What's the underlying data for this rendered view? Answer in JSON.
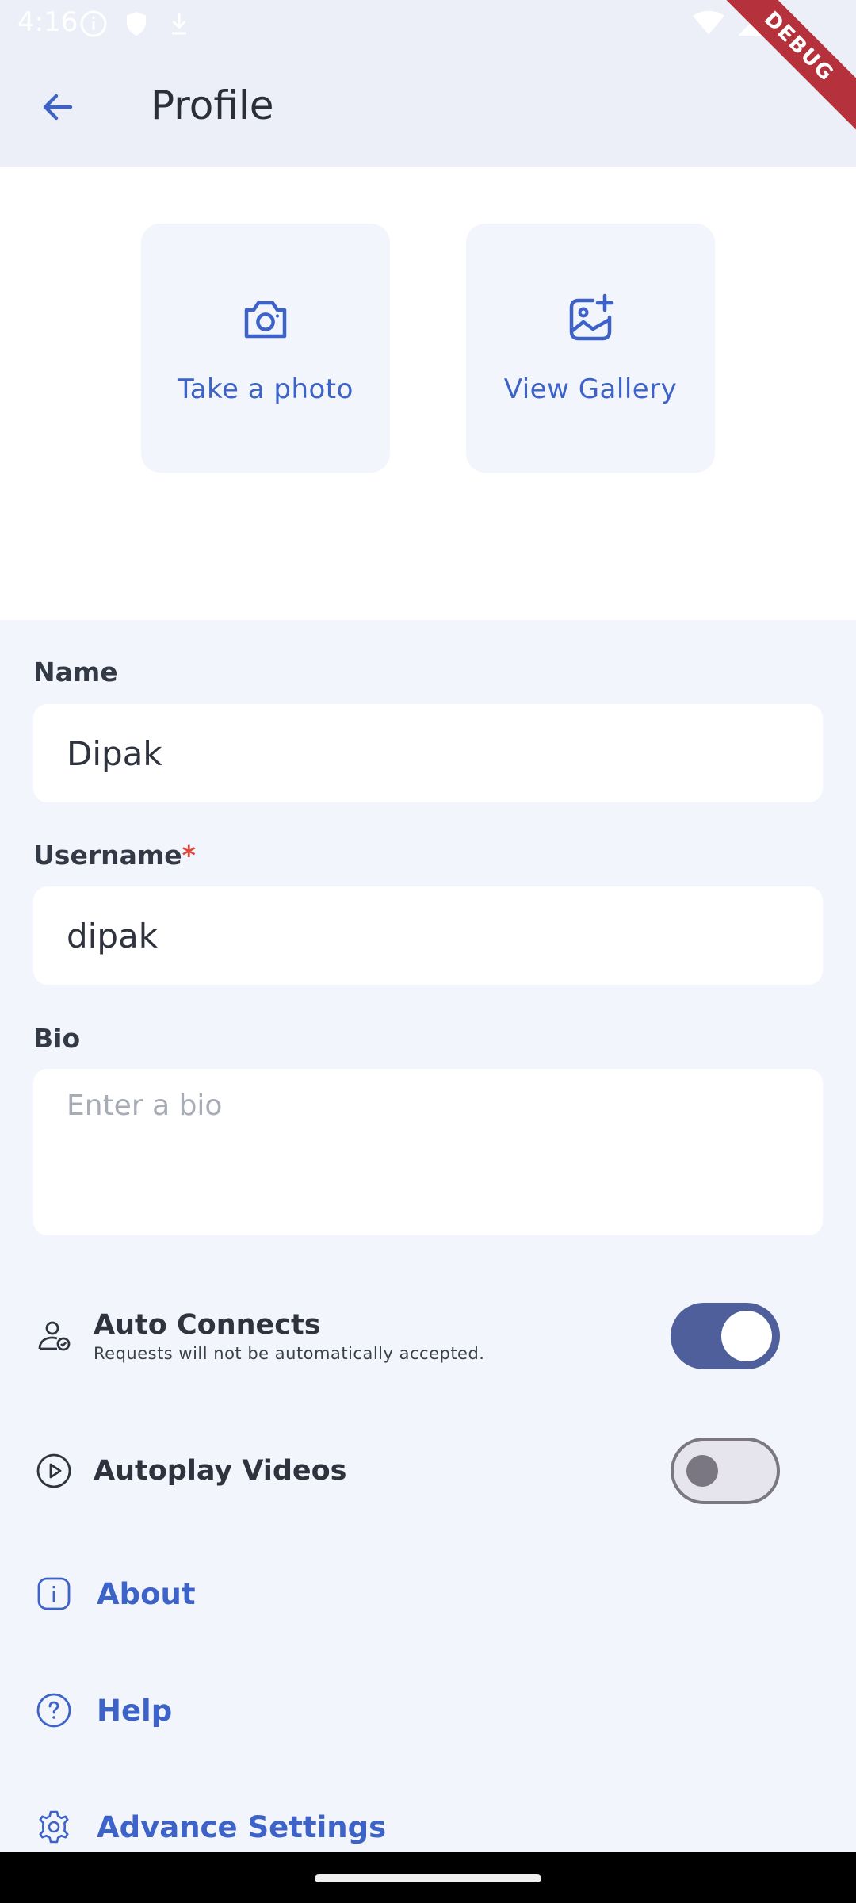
{
  "status_bar": {
    "time": "4:16",
    "debug_banner": "DEBUG"
  },
  "app_bar": {
    "title": "Profile"
  },
  "photo_options": {
    "take_photo_label": "Take a photo",
    "view_gallery_label": "View Gallery"
  },
  "form": {
    "name": {
      "label": "Name",
      "value": "Dipak"
    },
    "username": {
      "label": "Username",
      "required_marker": "*",
      "value": "dipak"
    },
    "bio": {
      "label": "Bio",
      "placeholder": "Enter a bio",
      "value": ""
    }
  },
  "settings": {
    "auto_connects": {
      "title": "Auto Connects",
      "subtitle": "Requests will not be automatically accepted.",
      "enabled": true
    },
    "autoplay_videos": {
      "title": "Autoplay Videos",
      "enabled": false
    },
    "links": [
      {
        "label": "About",
        "icon": "info-icon"
      },
      {
        "label": "Help",
        "icon": "help-icon"
      },
      {
        "label": "Advance Settings",
        "icon": "gear-icon"
      }
    ]
  },
  "colors": {
    "accent": "#3d63c8",
    "toggle_on": "#4f5f9c",
    "required": "#e0453a",
    "debug_ribbon": "#b5323c"
  }
}
